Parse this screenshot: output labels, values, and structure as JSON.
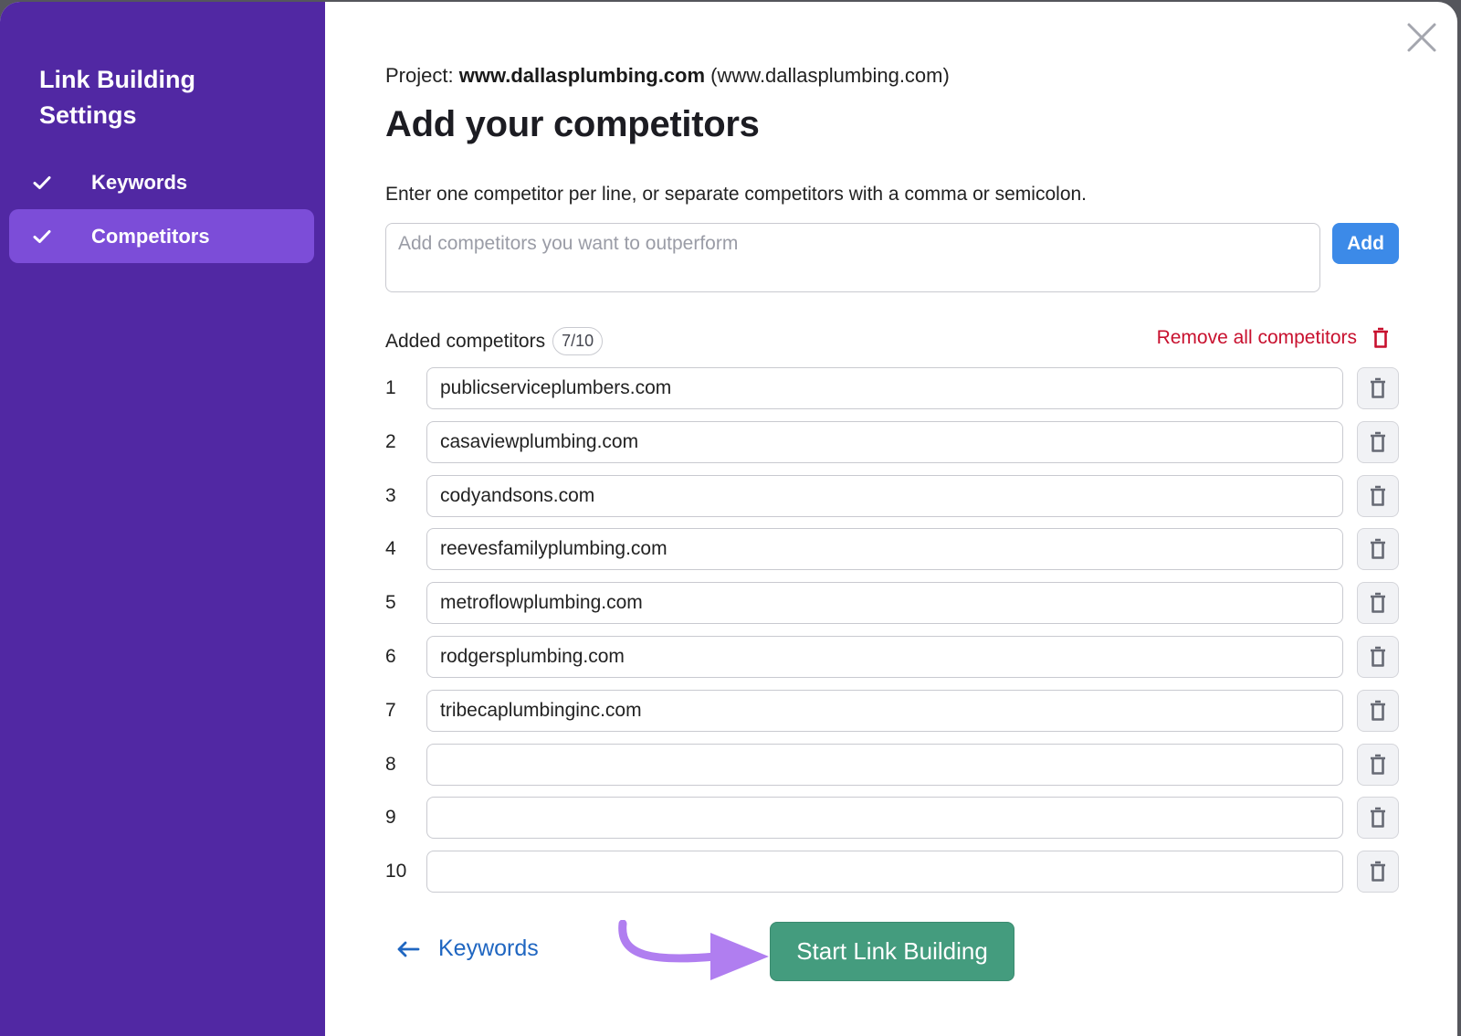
{
  "sidebar": {
    "title": "Link Building Settings",
    "items": [
      {
        "label": "Keywords",
        "icon": "check-icon",
        "completed": true,
        "active": false
      },
      {
        "label": "Competitors",
        "icon": "check-icon",
        "completed": true,
        "active": true
      }
    ]
  },
  "header": {
    "project_prefix": "Project:",
    "project_name": "www.dallasplumbing.com",
    "project_domain": "(www.dallasplumbing.com)",
    "title": "Add your competitors",
    "close_icon": "close-icon"
  },
  "input": {
    "hint": "Enter one competitor per line, or separate competitors with a comma or semicolon.",
    "placeholder": "Add competitors you want to outperform",
    "value": "",
    "add_label": "Add"
  },
  "competitors": {
    "label": "Added competitors",
    "count": "7/10",
    "remove_all_label": "Remove all competitors",
    "remove_icon": "trash-icon",
    "rows": [
      {
        "num": "1",
        "value": "publicserviceplumbers.com"
      },
      {
        "num": "2",
        "value": "casaviewplumbing.com"
      },
      {
        "num": "3",
        "value": "codyandsons.com"
      },
      {
        "num": "4",
        "value": "reevesfamilyplumbing.com"
      },
      {
        "num": "5",
        "value": "metroflowplumbing.com"
      },
      {
        "num": "6",
        "value": "rodgersplumbing.com"
      },
      {
        "num": "7",
        "value": "tribecaplumbinginc.com"
      },
      {
        "num": "8",
        "value": ""
      },
      {
        "num": "9",
        "value": ""
      },
      {
        "num": "10",
        "value": ""
      }
    ]
  },
  "footer": {
    "back_label": "Keywords",
    "back_icon": "arrow-left-icon",
    "start_label": "Start Link Building",
    "annotation_icon": "curved-arrow-icon"
  },
  "colors": {
    "sidebar_bg": "#5128a3",
    "sidebar_active": "#7c4dd8",
    "primary_blue": "#3c8ae8",
    "link_blue": "#1f66c1",
    "danger_red": "#c8102e",
    "start_green": "#449c7e",
    "annotation_purple": "#b07ef0"
  }
}
